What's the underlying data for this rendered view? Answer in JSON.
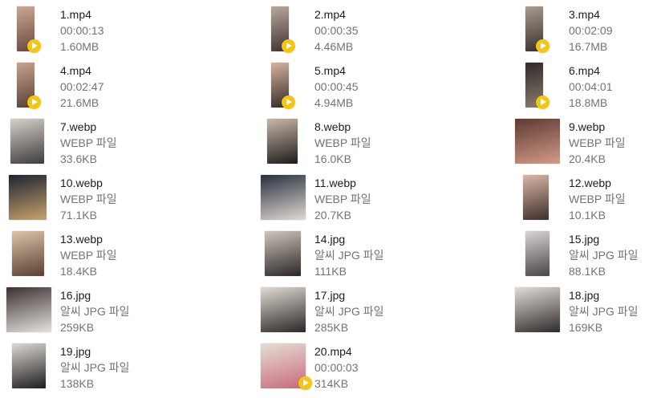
{
  "files": [
    {
      "name": "1.mp4",
      "detail": "00:00:13",
      "size": "1.60MB",
      "kind": "video",
      "thumb_colors": [
        "#c9a795",
        "#6a4a3d"
      ]
    },
    {
      "name": "2.mp4",
      "detail": "00:00:35",
      "size": "4.46MB",
      "kind": "video",
      "thumb_colors": [
        "#b8a89c",
        "#3f3432"
      ]
    },
    {
      "name": "3.mp4",
      "detail": "00:02:09",
      "size": "16.7MB",
      "kind": "video",
      "thumb_colors": [
        "#a99a8c",
        "#3b322e"
      ]
    },
    {
      "name": "4.mp4",
      "detail": "00:02:47",
      "size": "21.6MB",
      "kind": "video",
      "thumb_colors": [
        "#c7a18d",
        "#5a4135"
      ]
    },
    {
      "name": "5.mp4",
      "detail": "00:00:45",
      "size": "4.94MB",
      "kind": "video",
      "thumb_colors": [
        "#d4b29f",
        "#382a27"
      ]
    },
    {
      "name": "6.mp4",
      "detail": "00:04:01",
      "size": "18.8MB",
      "kind": "video",
      "thumb_colors": [
        "#2e2a28",
        "#8c7a6e"
      ]
    },
    {
      "name": "7.webp",
      "detail": "WEBP 파일",
      "size": "33.6KB",
      "kind": "image",
      "thumb_colors": [
        "#d7d0c8",
        "#3e3c3e"
      ]
    },
    {
      "name": "8.webp",
      "detail": "WEBP 파일",
      "size": "16.0KB",
      "kind": "image",
      "thumb_colors": [
        "#c8b7a6",
        "#1e1b1b"
      ]
    },
    {
      "name": "9.webp",
      "detail": "WEBP 파일",
      "size": "20.4KB",
      "kind": "image",
      "thumb_colors": [
        "#5c3a33",
        "#d49a86"
      ]
    },
    {
      "name": "10.webp",
      "detail": "WEBP 파일",
      "size": "71.1KB",
      "kind": "image",
      "thumb_colors": [
        "#1d2332",
        "#c9a26b"
      ]
    },
    {
      "name": "11.webp",
      "detail": "WEBP 파일",
      "size": "20.7KB",
      "kind": "image",
      "thumb_colors": [
        "#26303e",
        "#e3d8d3"
      ]
    },
    {
      "name": "12.webp",
      "detail": "WEBP 파일",
      "size": "10.1KB",
      "kind": "image",
      "thumb_colors": [
        "#d9b7a6",
        "#3d2f2a"
      ]
    },
    {
      "name": "13.webp",
      "detail": "WEBP 파일",
      "size": "18.4KB",
      "kind": "image",
      "thumb_colors": [
        "#dcc3a9",
        "#5a4032"
      ]
    },
    {
      "name": "14.jpg",
      "detail": "알씨 JPG 파일",
      "size": "111KB",
      "kind": "image",
      "thumb_colors": [
        "#cfc6bd",
        "#2a2626"
      ]
    },
    {
      "name": "15.jpg",
      "detail": "알씨 JPG 파일",
      "size": "88.1KB",
      "kind": "image",
      "thumb_colors": [
        "#d8d4d2",
        "#4a4546"
      ]
    },
    {
      "name": "16.jpg",
      "detail": "알씨 JPG 파일",
      "size": "259KB",
      "kind": "image",
      "thumb_colors": [
        "#3a3130",
        "#e6e2e0"
      ]
    },
    {
      "name": "17.jpg",
      "detail": "알씨 JPG 파일",
      "size": "285KB",
      "kind": "image",
      "thumb_colors": [
        "#e1dbd3",
        "#2b2727"
      ]
    },
    {
      "name": "18.jpg",
      "detail": "알씨 JPG 파일",
      "size": "169KB",
      "kind": "image",
      "thumb_colors": [
        "#e3ddd8",
        "#2f2b2b"
      ]
    },
    {
      "name": "19.jpg",
      "detail": "알씨 JPG 파일",
      "size": "138KB",
      "kind": "image",
      "thumb_colors": [
        "#ddd8d3",
        "#1f1d1f"
      ]
    },
    {
      "name": "20.mp4",
      "detail": "00:00:03",
      "size": "314KB",
      "kind": "video",
      "thumb_colors": [
        "#e6ddd6",
        "#c86a7a"
      ]
    }
  ],
  "play_badge_color": "#f3c612"
}
